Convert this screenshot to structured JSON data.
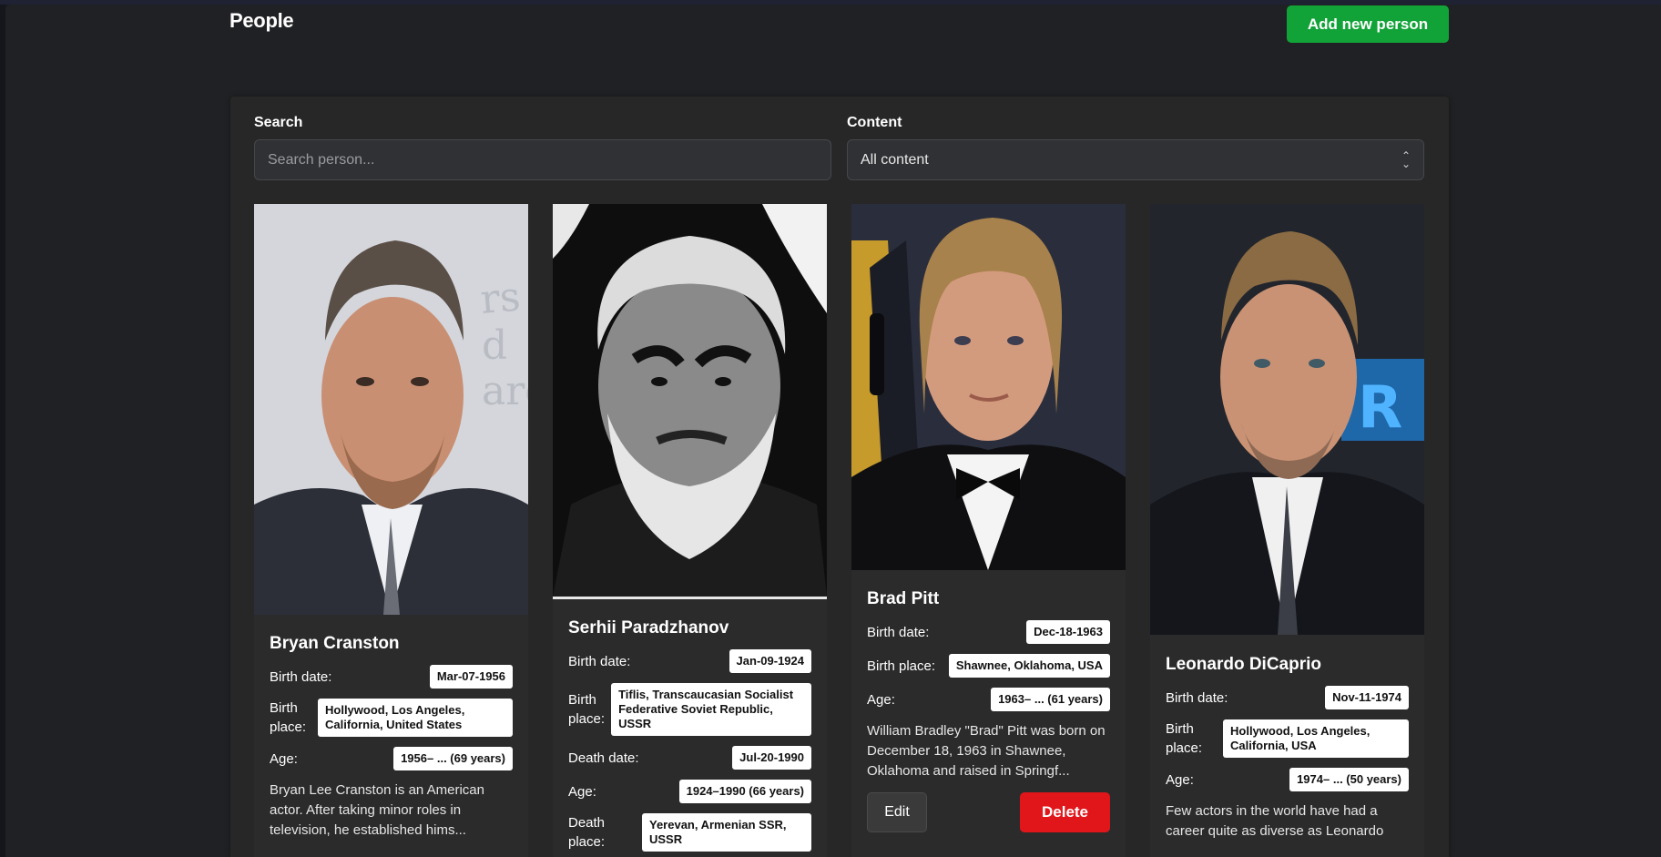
{
  "header": {
    "title": "People",
    "add_button_label": "Add new person"
  },
  "filters": {
    "search_label": "Search",
    "search_placeholder": "Search person...",
    "content_label": "Content",
    "content_selected": "All content"
  },
  "people": [
    {
      "name": "Bryan Cranston",
      "birth_date_label": "Birth date:",
      "birth_date": "Mar-07-1956",
      "birth_place_label": "Birth place:",
      "birth_place": "Hollywood, Los Angeles, California, United States",
      "age_label": "Age:",
      "age": "1956– ... (69 years)",
      "description": "Bryan Lee Cranston is an American actor. After taking minor roles in television, he established hims..."
    },
    {
      "name": "Serhii Paradzhanov",
      "birth_date_label": "Birth date:",
      "birth_date": "Jan-09-1924",
      "birth_place_label": "Birth place:",
      "birth_place": "Tiflis, Transcaucasian Socialist Federative Soviet Republic, USSR",
      "death_date_label": "Death date:",
      "death_date": "Jul-20-1990",
      "age_label": "Age:",
      "age": "1924–1990 (66 years)",
      "death_place_label": "Death place:",
      "death_place": "Yerevan, Armenian SSR, USSR"
    },
    {
      "name": "Brad Pitt",
      "birth_date_label": "Birth date:",
      "birth_date": "Dec-18-1963",
      "birth_place_label": "Birth place:",
      "birth_place": "Shawnee, Oklahoma, USA",
      "age_label": "Age:",
      "age": "1963– ... (61 years)",
      "description": "William Bradley \"Brad\" Pitt was born on December 18, 1963 in Shawnee, Oklahoma and raised in Springf...",
      "edit_label": "Edit",
      "delete_label": "Delete"
    },
    {
      "name": "Leonardo DiCaprio",
      "birth_date_label": "Birth date:",
      "birth_date": "Nov-11-1974",
      "birth_place_label": "Birth place:",
      "birth_place": "Hollywood, Los Angeles, California, USA",
      "age_label": "Age:",
      "age": "1974– ... (50 years)",
      "description": "Few actors in the world have had a career quite as diverse as Leonardo"
    }
  ],
  "colors": {
    "add_button": "#12a338",
    "delete_button": "#e0161b",
    "panel": "#272727",
    "card": "#2b2b2b"
  }
}
